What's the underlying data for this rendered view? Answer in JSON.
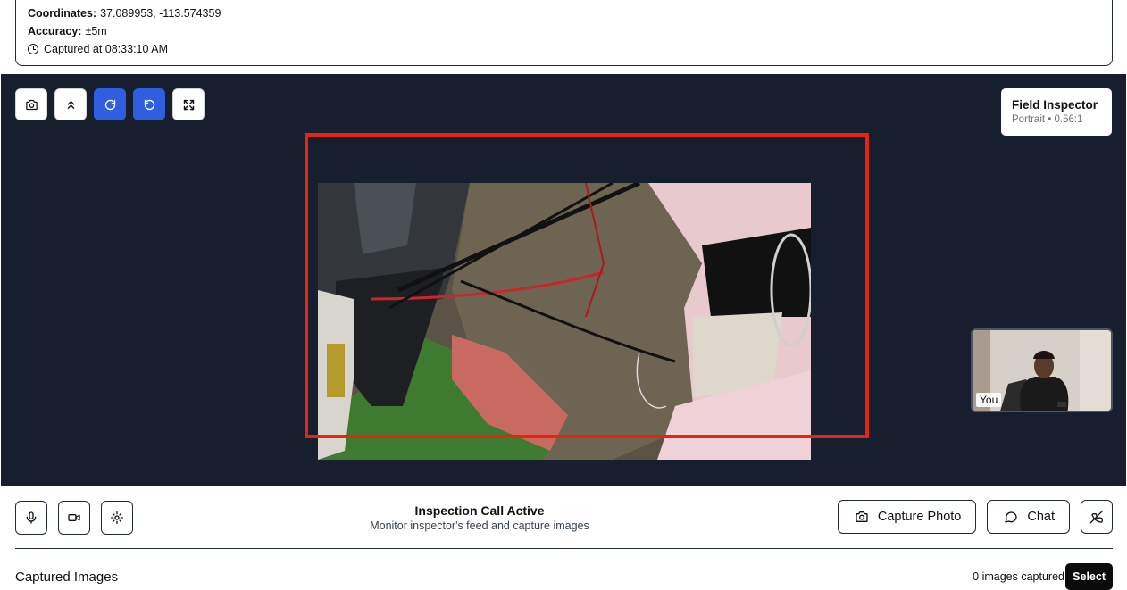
{
  "location": {
    "coordinates_label": "Coordinates:",
    "coordinates_value": "37.089953, -113.574359",
    "accuracy_label": "Accuracy:",
    "accuracy_value": "±5m",
    "captured_at": "Captured at 08:33:10 AM"
  },
  "video_controls": [
    {
      "icon": "camera-icon"
    },
    {
      "icon": "chevrons-up-icon"
    },
    {
      "icon": "rotate-cw-icon",
      "active": true
    },
    {
      "icon": "rotate-ccw-icon",
      "active": true
    },
    {
      "icon": "fullscreen-icon"
    }
  ],
  "inspector": {
    "name": "Field Inspector",
    "meta": "Portrait • 0.56:1"
  },
  "self_view": {
    "label": "You"
  },
  "call": {
    "title": "Inspection Call Active",
    "subtitle": "Monitor inspector's feed and capture images",
    "capture_label": "Capture Photo",
    "chat_label": "Chat"
  },
  "captured": {
    "title": "Captured Images",
    "count": "0 images captured",
    "select_label": "Select"
  },
  "colors": {
    "stage_bg": "#171e2e",
    "accent_blue": "#2f5fe0",
    "highlight_red": "#e8230e"
  }
}
